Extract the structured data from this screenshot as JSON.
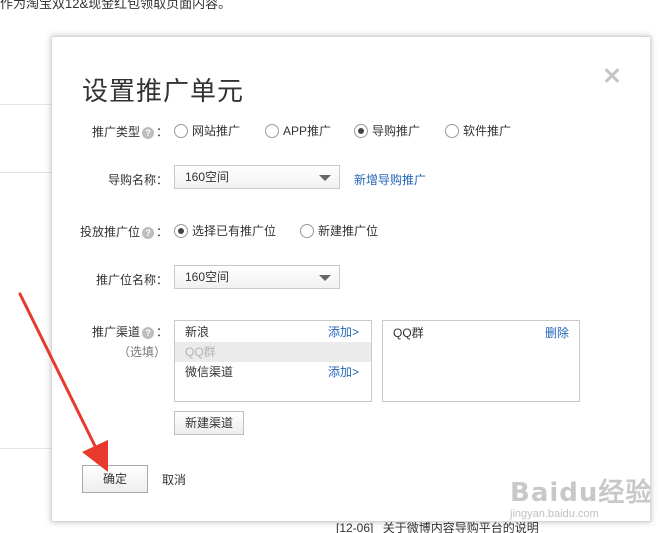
{
  "background": {
    "top_text": "作为淘宝双12&现金红包领取页面内容。",
    "news_date": "[12-06]",
    "news_title": "关于微博内容导购平台的说明"
  },
  "modal": {
    "title": "设置推广单元",
    "type_row": {
      "label": "推广类型",
      "options": [
        {
          "label": "网站推广",
          "checked": false
        },
        {
          "label": "APP推广",
          "checked": false
        },
        {
          "label": "导购推广",
          "checked": true
        },
        {
          "label": "软件推广",
          "checked": false
        }
      ]
    },
    "guide_name_row": {
      "label": "导购名称：",
      "value": "160空间",
      "new_link": "新增导购推广"
    },
    "slot_row": {
      "label": "投放推广位",
      "options": [
        {
          "label": "选择已有推广位",
          "checked": true
        },
        {
          "label": "新建推广位",
          "checked": false
        }
      ]
    },
    "slot_name_row": {
      "label": "推广位名称：",
      "value": "160空间"
    },
    "channel_row": {
      "label": "推广渠道",
      "optional": "（选填）",
      "available": [
        {
          "label": "新浪",
          "action": "添加>"
        },
        {
          "label": "QQ群",
          "action": ""
        },
        {
          "label": "微信渠道",
          "action": "添加>"
        }
      ],
      "selected": [
        {
          "label": "QQ群",
          "action": "删除"
        }
      ],
      "new_channel_button": "新建渠道"
    },
    "confirm_button": "确定",
    "cancel_link": "取消"
  },
  "watermark": {
    "text": "Baidu经验",
    "sub": "jingyan.baidu.com"
  },
  "icons": {
    "help": "question-circle-icon",
    "close": "close-icon",
    "dropdown": "caret-down-icon"
  },
  "colors": {
    "link": "#2466b8",
    "arrow": "#e8392d"
  }
}
